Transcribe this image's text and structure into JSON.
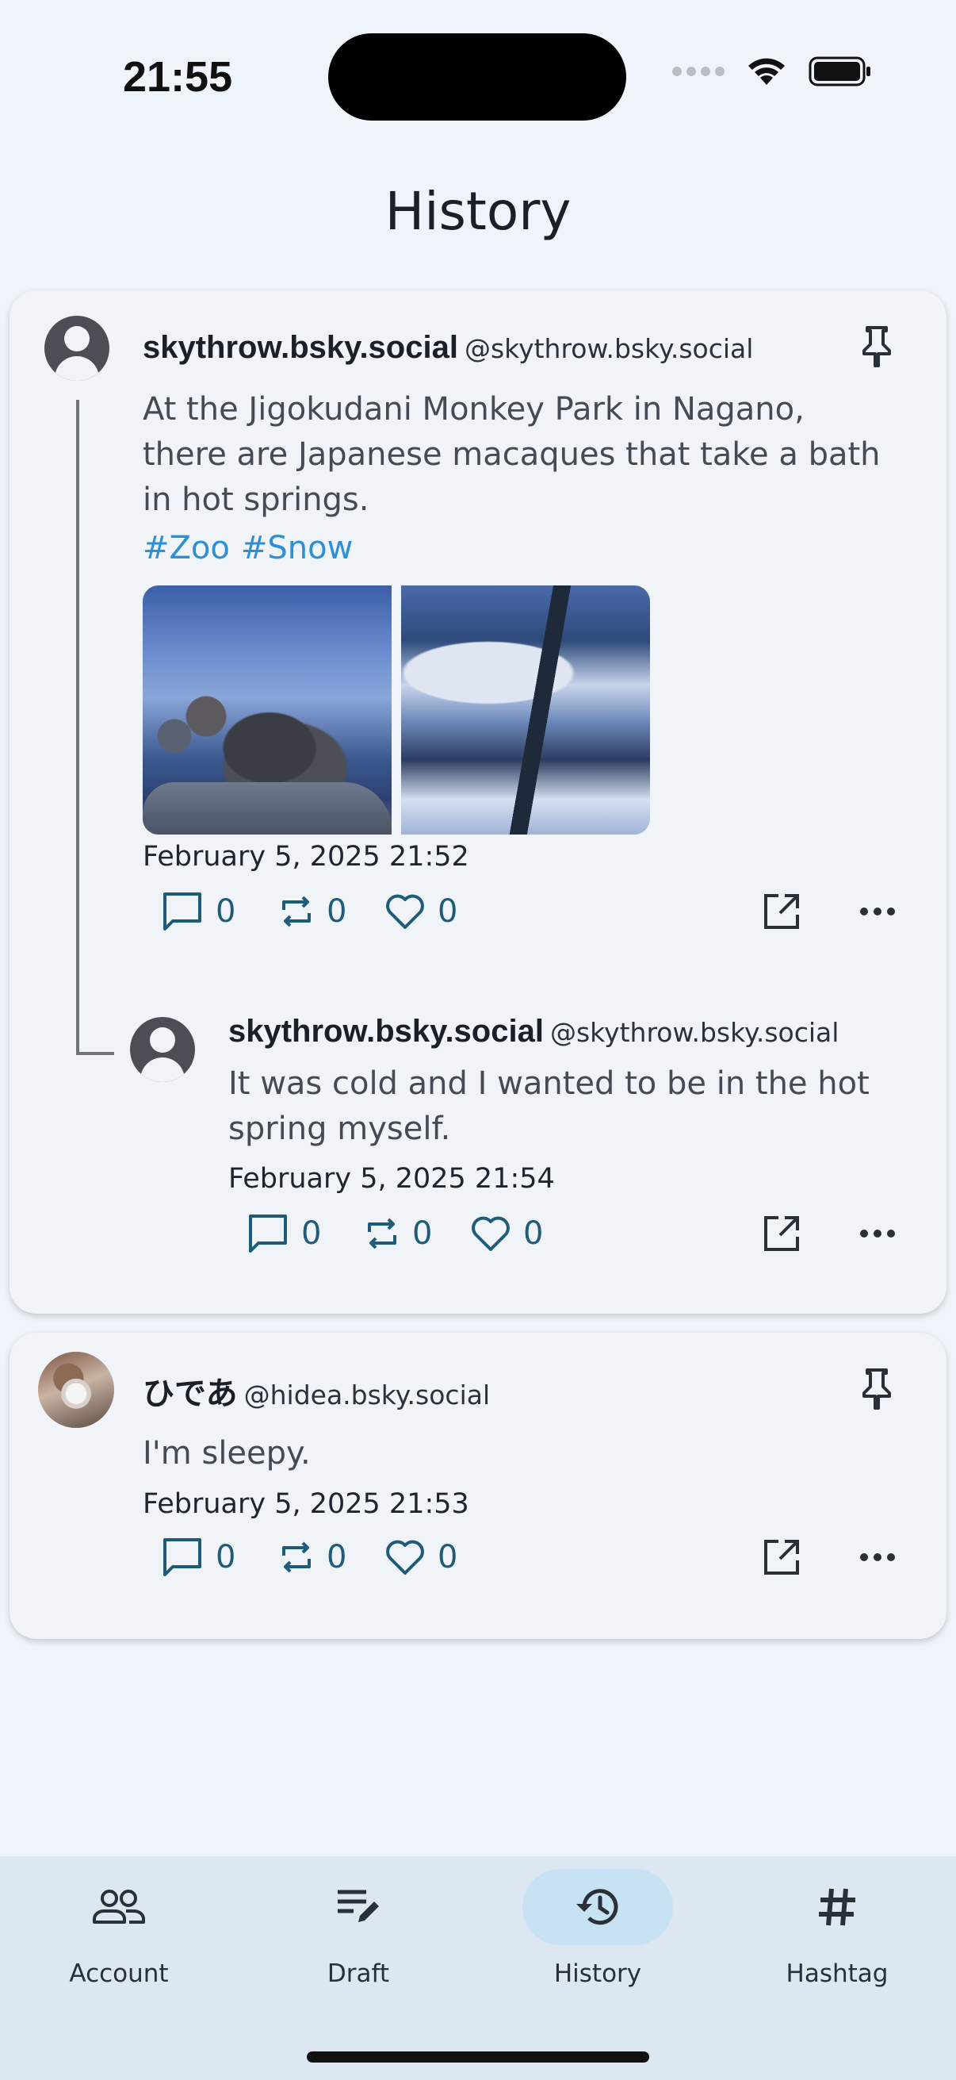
{
  "status_bar": {
    "time": "21:55"
  },
  "header": {
    "title": "History"
  },
  "thread": {
    "root_post": {
      "display_name": "skythrow.bsky.social",
      "handle": "@skythrow.bsky.social",
      "text_line1": "At the Jigokudani Monkey Park in Nagano,",
      "text_line2": "there are Japanese macaques that take a bath",
      "text_line3": "in hot springs.",
      "hashtags": [
        "#Zoo",
        "#Snow"
      ],
      "timestamp": "February 5, 2025 21:52",
      "reply_count": "0",
      "repost_count": "0",
      "like_count": "0"
    },
    "reply_post": {
      "display_name": "skythrow.bsky.social",
      "handle": "@skythrow.bsky.social",
      "text_line1": "It was cold and I wanted to be in the hot",
      "text_line2": "spring myself.",
      "timestamp": "February 5, 2025 21:54",
      "reply_count": "0",
      "repost_count": "0",
      "like_count": "0"
    }
  },
  "second_post": {
    "display_name": "ひであ",
    "handle": "@hidea.bsky.social",
    "text": "I'm sleepy.",
    "timestamp": "February 5, 2025 21:53",
    "reply_count": "0",
    "repost_count": "0",
    "like_count": "0"
  },
  "bottom_nav": {
    "items": [
      {
        "label": "Account",
        "icon": "people-icon"
      },
      {
        "label": "Draft",
        "icon": "edit-note-icon"
      },
      {
        "label": "History",
        "icon": "history-icon",
        "active": true
      },
      {
        "label": "Hashtag",
        "icon": "hashtag-icon"
      }
    ]
  },
  "colors": {
    "accent": "#1e5c78",
    "hashtag": "#2d8fd6",
    "active_nav": "#c7e2f3",
    "background": "#eef4fa"
  }
}
